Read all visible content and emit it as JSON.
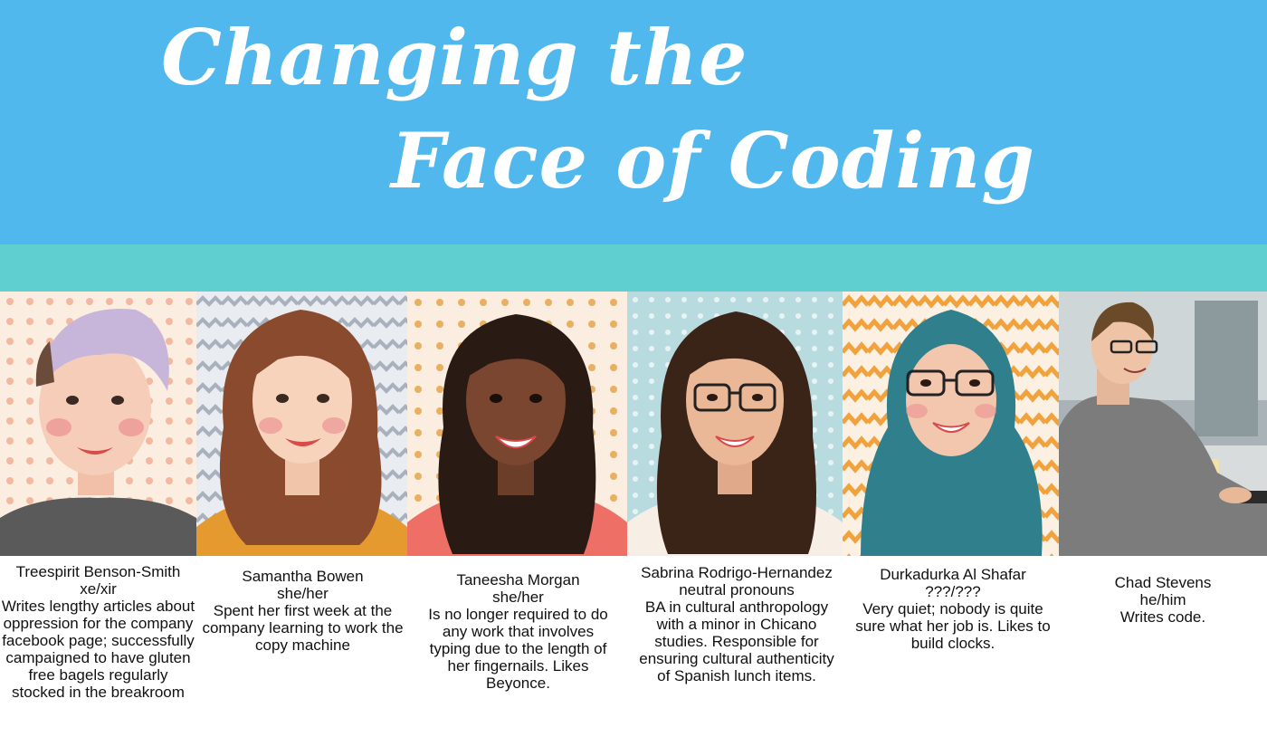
{
  "title": {
    "line1": "Changing the",
    "line2": "Face of Coding"
  },
  "colors": {
    "banner": "#50b8ec",
    "stripe": "#5fcfcf",
    "title_text": "#ffffff"
  },
  "people": [
    {
      "name": "Treespirit Benson-Smith",
      "pronouns": "xe/xir",
      "description": "Writes lengthy articles about oppression for the company facebook page; successfully campaigned to have gluten free bagels regularly stocked in the breakroom"
    },
    {
      "name": "Samantha Bowen",
      "pronouns": "she/her",
      "description": "Spent her first week at the company learning to work the copy machine"
    },
    {
      "name": "Taneesha Morgan",
      "pronouns": "she/her",
      "description": "Is no longer required to do any work that involves typing due to the length of her fingernails.  Likes Beyonce."
    },
    {
      "name": "Sabrina Rodrigo-Hernandez",
      "pronouns": "neutral pronouns",
      "description": "BA in cultural anthropology with a minor in Chicano studies.  Responsible for ensuring cultural authenticity of Spanish lunch items."
    },
    {
      "name": "Durkadurka Al Shafar",
      "pronouns": "???/???",
      "description": "Very quiet; nobody is quite sure what her job is.  Likes to build clocks."
    },
    {
      "name": "Chad Stevens",
      "pronouns": "he/him",
      "description": "Writes code."
    }
  ]
}
